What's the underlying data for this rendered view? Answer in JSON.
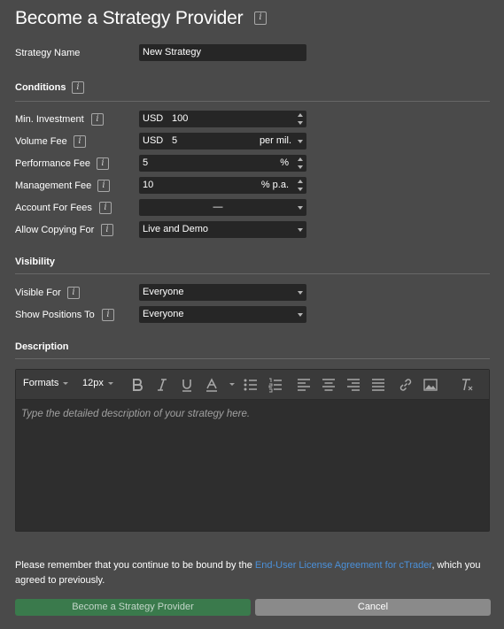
{
  "dialog": {
    "title": "Become a Strategy Provider",
    "info_glyph": "i"
  },
  "strategy_name": {
    "label": "Strategy Name",
    "value": "New Strategy"
  },
  "conditions": {
    "heading": "Conditions",
    "min_investment": {
      "label": "Min. Investment",
      "currency": "USD",
      "value": "100"
    },
    "volume_fee": {
      "label": "Volume Fee",
      "currency": "USD",
      "value": "5",
      "unit": "per mil."
    },
    "performance_fee": {
      "label": "Performance Fee",
      "value": "5",
      "unit": "%"
    },
    "management_fee": {
      "label": "Management Fee",
      "value": "10",
      "unit": "% p.a."
    },
    "account_for_fees": {
      "label": "Account For Fees",
      "value": "—"
    },
    "allow_copying_for": {
      "label": "Allow Copying For",
      "value": "Live and Demo"
    }
  },
  "visibility": {
    "heading": "Visibility",
    "visible_for": {
      "label": "Visible For",
      "value": "Everyone"
    },
    "show_positions_to": {
      "label": "Show Positions To",
      "value": "Everyone"
    }
  },
  "description": {
    "heading": "Description",
    "toolbar": {
      "formats_label": "Formats",
      "font_size_label": "12px"
    },
    "placeholder": "Type the detailed description of your strategy here."
  },
  "notice": {
    "text_before": "Please remember that you continue to be bound by the ",
    "link_text": "End-User License Agreement for cTrader",
    "text_after": ", which you agreed to previously."
  },
  "buttons": {
    "submit_label": "Become a Strategy Provider",
    "cancel_label": "Cancel"
  },
  "colors": {
    "background": "#4a4a4a",
    "field": "#262626",
    "primary_button": "#3a7a4c",
    "cancel_button": "#8a8a8a",
    "link": "#4a90d9"
  }
}
